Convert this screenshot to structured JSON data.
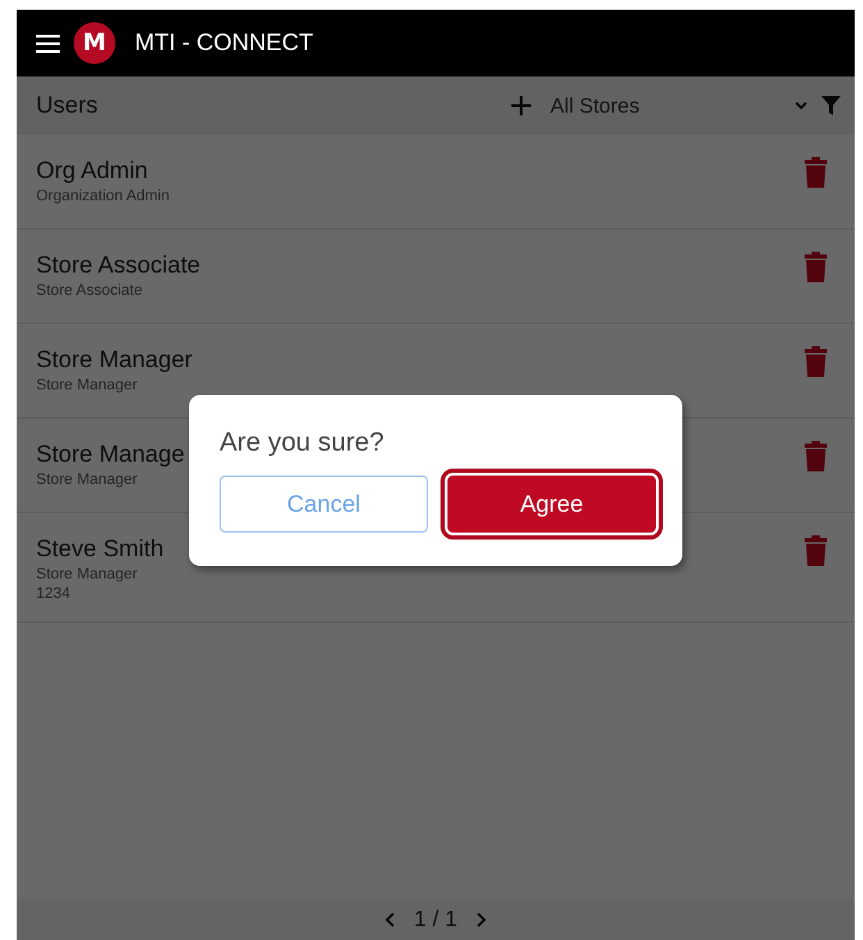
{
  "app_bar": {
    "title": "MTI - CONNECT",
    "logo": "M"
  },
  "toolbar": {
    "title": "Users",
    "store_filter": "All Stores"
  },
  "users": [
    {
      "name": "Org Admin",
      "details": [
        "Organization Admin"
      ]
    },
    {
      "name": "Store Associate",
      "details": [
        "Store Associate"
      ]
    },
    {
      "name": "Store Manager",
      "details": [
        "Store Manager"
      ]
    },
    {
      "name": "Store Manage",
      "details": [
        "Store Manager"
      ]
    },
    {
      "name": "Steve Smith",
      "details": [
        "Store Manager",
        "1234"
      ]
    }
  ],
  "pager": {
    "label": "1 / 1"
  },
  "dialog": {
    "message": "Are you sure?",
    "buttons": [
      {
        "label": "Cancel",
        "kind": "secondary",
        "focused": false
      },
      {
        "label": "Agree",
        "kind": "primary",
        "focused": true
      }
    ]
  }
}
